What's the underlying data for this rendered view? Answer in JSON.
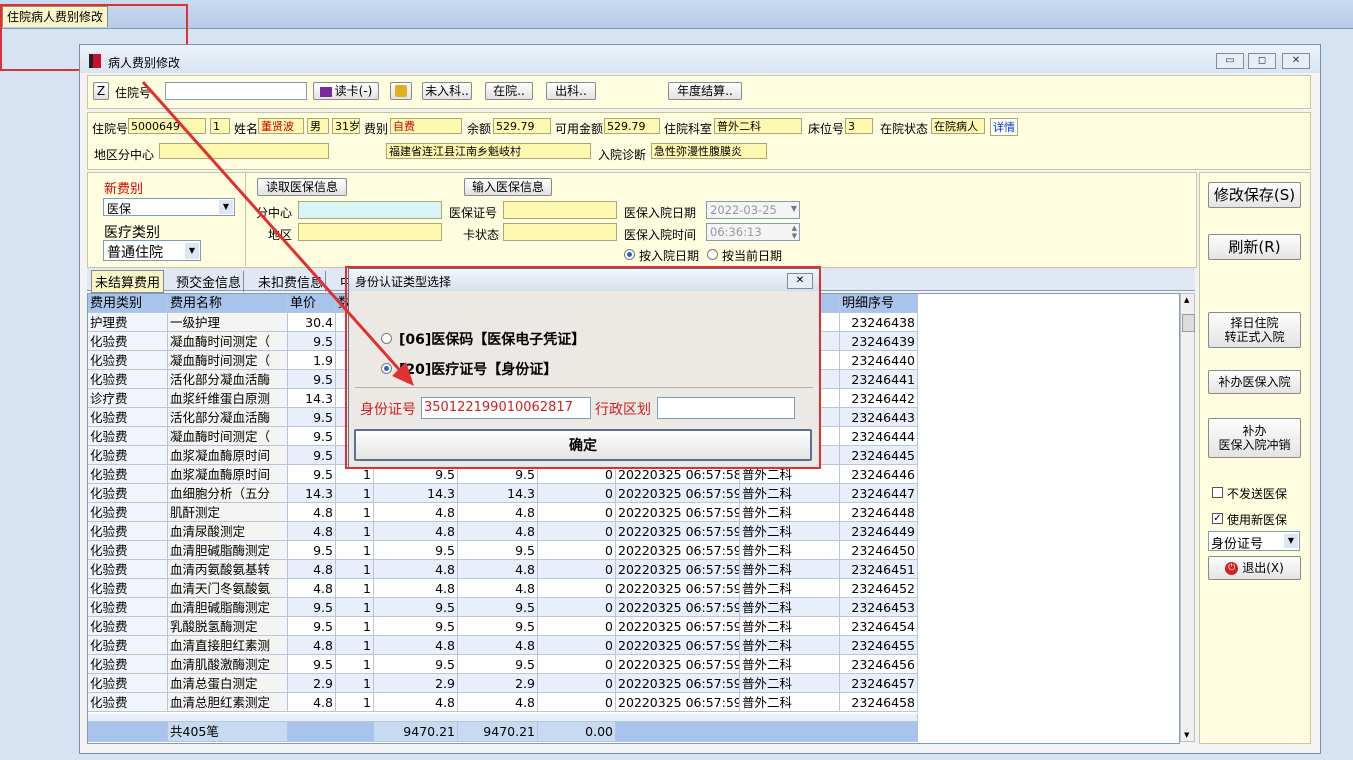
{
  "top_tab": "住院病人费别修改",
  "window": {
    "title": "病人费别修改",
    "min": "▭",
    "max": "◻",
    "close": "✕"
  },
  "toolbar": {
    "z_label": "Z",
    "admission_label": "住院号",
    "admission_value": "",
    "read_card": "读卡(-)",
    "not_admitted": "未入科..",
    "in_hospital": "在院..",
    "discharged": "出科..",
    "annual": "年度结算.."
  },
  "patient": {
    "id_label": "住院号",
    "id": "5000649",
    "seq": "1",
    "name_label": "姓名",
    "name": "董贤波",
    "sex": "男",
    "age": "31岁",
    "category_label": "费别",
    "category": "自费",
    "balance_label": "余额",
    "balance": "529.79",
    "available_label": "可用金额",
    "available": "529.79",
    "dept_label": "住院科室",
    "dept": "普外二科",
    "bed_label": "床位号",
    "bed": "3",
    "status_label": "在院状态",
    "status": "在院病人",
    "detail": "详情",
    "region_label": "地区分中心",
    "region": "",
    "address": "福建省连江县江南乡魁岐村",
    "diagnosis_label": "入院诊断",
    "diagnosis": "急性弥漫性腹膜炎"
  },
  "new_category": {
    "title": "新费别",
    "value": "医保",
    "type_label": "医疗类别",
    "type_value": "普通住院"
  },
  "insurance": {
    "read_btn": "读取医保信息",
    "input_btn": "输入医保信息",
    "center_label": "分中心",
    "region_label": "地区",
    "card_no_label": "医保证号",
    "card_status_label": "卡状态",
    "admit_date_label": "医保入院日期",
    "admit_date": "2022-03-25",
    "admit_time_label": "医保入院时间",
    "admit_time": "06:36:13",
    "by_admit_date": "按入院日期",
    "by_current_date": "按当前日期"
  },
  "tabs": [
    "未结算费用",
    "预交金信息",
    "未扣费信息",
    "中"
  ],
  "columns": [
    "费用类别",
    "费用名称",
    "单价",
    "数",
    "",
    "",
    "",
    "",
    "",
    "明细序号"
  ],
  "rows": [
    [
      "护理费",
      "一级护理",
      "30.4",
      "",
      "",
      "",
      "",
      "",
      "",
      "23246438"
    ],
    [
      "化验费",
      "凝血酶时间测定（",
      "9.5",
      "",
      "",
      "",
      "",
      "",
      "",
      "23246439"
    ],
    [
      "化验费",
      "凝血酶时间测定（",
      "1.9",
      "",
      "",
      "",
      "",
      "",
      "",
      "23246440"
    ],
    [
      "化验费",
      "活化部分凝血活酶",
      "9.5",
      "",
      "",
      "",
      "",
      "",
      "",
      "23246441"
    ],
    [
      "诊疗费",
      "血浆纤维蛋白原测",
      "14.3",
      "",
      "",
      "",
      "",
      "",
      "",
      "23246442"
    ],
    [
      "化验费",
      "活化部分凝血活酶",
      "9.5",
      "",
      "",
      "",
      "",
      "",
      "",
      "23246443"
    ],
    [
      "化验费",
      "凝血酶时间测定（",
      "9.5",
      "",
      "",
      "",
      "",
      "",
      "",
      "23246444"
    ],
    [
      "化验费",
      "血浆凝血酶原时间",
      "9.5",
      "",
      "",
      "",
      "",
      "",
      "",
      "23246445"
    ],
    [
      "化验费",
      "血浆凝血酶原时间",
      "9.5",
      "1",
      "9.5",
      "9.5",
      "0",
      "20220325 06:57:58",
      "普外二科",
      "23246446"
    ],
    [
      "化验费",
      "血细胞分析（五分",
      "14.3",
      "1",
      "14.3",
      "14.3",
      "0",
      "20220325 06:57:59",
      "普外二科",
      "23246447"
    ],
    [
      "化验费",
      "肌酐测定",
      "4.8",
      "1",
      "4.8",
      "4.8",
      "0",
      "20220325 06:57:59",
      "普外二科",
      "23246448"
    ],
    [
      "化验费",
      "血清尿酸测定",
      "4.8",
      "1",
      "4.8",
      "4.8",
      "0",
      "20220325 06:57:59",
      "普外二科",
      "23246449"
    ],
    [
      "化验费",
      "血清胆碱脂酶测定",
      "9.5",
      "1",
      "9.5",
      "9.5",
      "0",
      "20220325 06:57:59",
      "普外二科",
      "23246450"
    ],
    [
      "化验费",
      "血清丙氨酸氨基转",
      "4.8",
      "1",
      "4.8",
      "4.8",
      "0",
      "20220325 06:57:59",
      "普外二科",
      "23246451"
    ],
    [
      "化验费",
      "血清天门冬氨酸氨",
      "4.8",
      "1",
      "4.8",
      "4.8",
      "0",
      "20220325 06:57:59",
      "普外二科",
      "23246452"
    ],
    [
      "化验费",
      "血清胆碱脂酶测定",
      "9.5",
      "1",
      "9.5",
      "9.5",
      "0",
      "20220325 06:57:59",
      "普外二科",
      "23246453"
    ],
    [
      "化验费",
      "乳酸脱氢酶测定",
      "9.5",
      "1",
      "9.5",
      "9.5",
      "0",
      "20220325 06:57:59",
      "普外二科",
      "23246454"
    ],
    [
      "化验费",
      "血清直接胆红素测",
      "4.8",
      "1",
      "4.8",
      "4.8",
      "0",
      "20220325 06:57:59",
      "普外二科",
      "23246455"
    ],
    [
      "化验费",
      "血清肌酸激酶测定",
      "9.5",
      "1",
      "9.5",
      "9.5",
      "0",
      "20220325 06:57:59",
      "普外二科",
      "23246456"
    ],
    [
      "化验费",
      "血清总蛋白测定",
      "2.9",
      "1",
      "2.9",
      "2.9",
      "0",
      "20220325 06:57:59",
      "普外二科",
      "23246457"
    ],
    [
      "化验费",
      "血清总胆红素测定",
      "4.8",
      "1",
      "4.8",
      "4.8",
      "0",
      "20220325 06:57:59",
      "普外二科",
      "23246458"
    ]
  ],
  "footer": {
    "count": "共405笔",
    "total1": "9470.21",
    "total2": "9470.21",
    "total3": "0.00"
  },
  "side": {
    "save": "修改保存(S)",
    "refresh": "刷新(R)",
    "convert_1": "择日住院",
    "convert_2": "转正式入院",
    "supplement": "补办医保入院",
    "cancel_1": "补办",
    "cancel_2": "医保入院冲销",
    "no_send": "不发送医保",
    "use_new": "使用新医保",
    "id_type": "身份证号",
    "exit": "退出(X)"
  },
  "dialog": {
    "title": "身份认证类型选择",
    "opt1": "[06]医保码【医保电子凭证】",
    "opt2": "[20]医疗证号【身份证】",
    "id_label": "身份证号",
    "id_value": "350122199010062817",
    "district_label": "行政区划",
    "district_value": "",
    "confirm": "确定"
  },
  "colors": {
    "accent_red": "#e03030",
    "field_yellow": "#fff8b0",
    "header_blue": "#a9c4ec"
  }
}
